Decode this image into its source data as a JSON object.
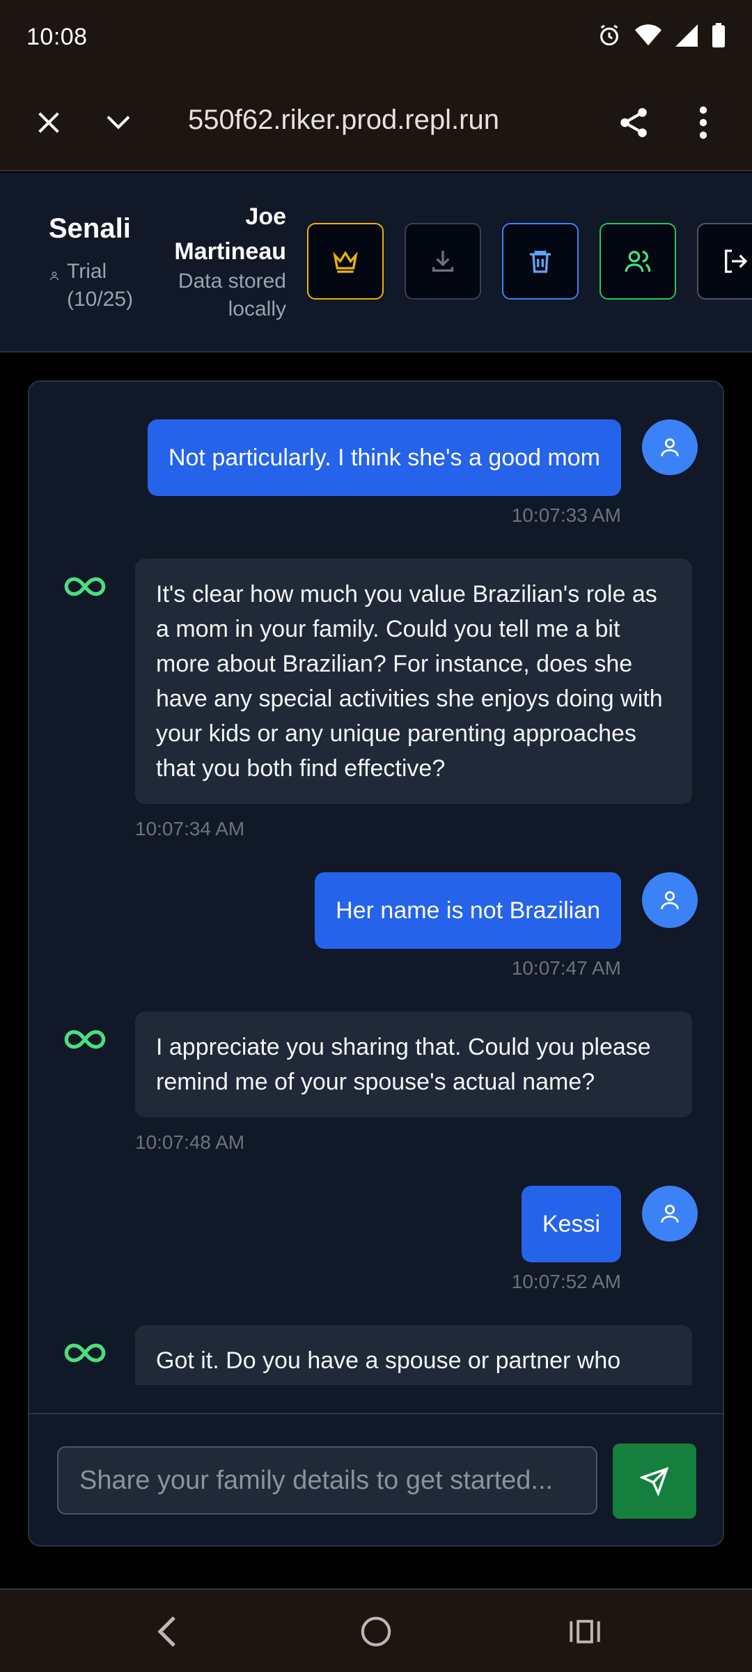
{
  "status_bar": {
    "time": "10:08",
    "icons": [
      "alarm-icon",
      "wifi-icon",
      "signal-icon",
      "battery-icon"
    ]
  },
  "browser": {
    "url": "550f62.riker.prod.repl.run"
  },
  "header": {
    "brand": "Senali",
    "plan": "Trial",
    "plan_usage": "(10/25)",
    "user_name": "Joe Martineau",
    "storage_note": "Data stored locally",
    "buttons": [
      "crown-icon",
      "download-icon",
      "trash-icon",
      "users-icon",
      "logout-icon"
    ]
  },
  "messages": [
    {
      "role": "user",
      "text": "Not particularly.  I think she's a good mom",
      "time": "10:07:33 AM"
    },
    {
      "role": "assistant",
      "text": "It's clear how much you value Brazilian's role as a mom in your family. Could you tell me a bit more about Brazilian? For instance, does she have any special activities she enjoys doing with your kids or any unique parenting approaches that you both find effective?",
      "time": "10:07:34 AM"
    },
    {
      "role": "user",
      "text": "Her name is not Brazilian",
      "time": "10:07:47 AM"
    },
    {
      "role": "assistant",
      "text": "I appreciate you sharing that. Could you please remind me of your spouse's actual name?",
      "time": "10:07:48 AM"
    },
    {
      "role": "user",
      "text": "Kessi",
      "time": "10:07:52 AM"
    },
    {
      "role": "assistant",
      "text": "Got it. Do you have a spouse or partner who",
      "time": ""
    }
  ],
  "composer": {
    "placeholder": "Share your family details to get started..."
  },
  "colors": {
    "accent_blue": "#2563eb",
    "send_green": "#15803d",
    "infinity_green": "#4ade80",
    "premium_gold": "#eab308"
  }
}
